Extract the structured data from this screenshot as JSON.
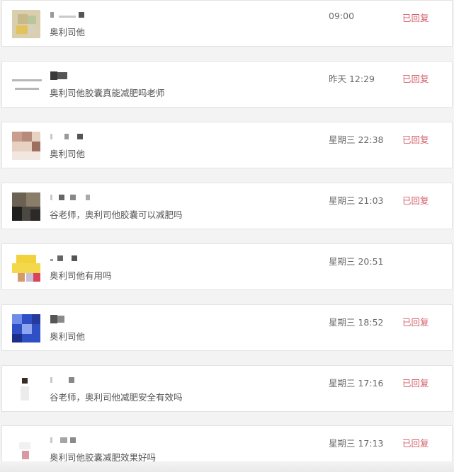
{
  "messages": [
    {
      "time": "09:00",
      "text": "奥利司他",
      "status": "已回复"
    },
    {
      "time": "昨天 12:29",
      "text": "奥利司他胶囊真能减肥吗老师",
      "status": "已回复"
    },
    {
      "time": "星期三 22:38",
      "text": "奥利司他",
      "status": "已回复"
    },
    {
      "time": "星期三 21:03",
      "text": "谷老师，奥利司他胶囊可以减肥吗",
      "status": "已回复"
    },
    {
      "time": "星期三 20:51",
      "text": "奥利司他有用吗",
      "status": ""
    },
    {
      "time": "星期三 18:52",
      "text": "奥利司他",
      "status": "已回复"
    },
    {
      "time": "星期三 17:16",
      "text": "谷老师，奥利司他减肥安全有效吗",
      "status": "已回复"
    },
    {
      "time": "星期三 17:13",
      "text": "奥利司他胶囊减肥效果好吗",
      "status": "已回复"
    }
  ],
  "colors": {
    "status": "#d25e6a",
    "card_bg": "#ffffff",
    "page_bg": "#f3f3f3"
  }
}
